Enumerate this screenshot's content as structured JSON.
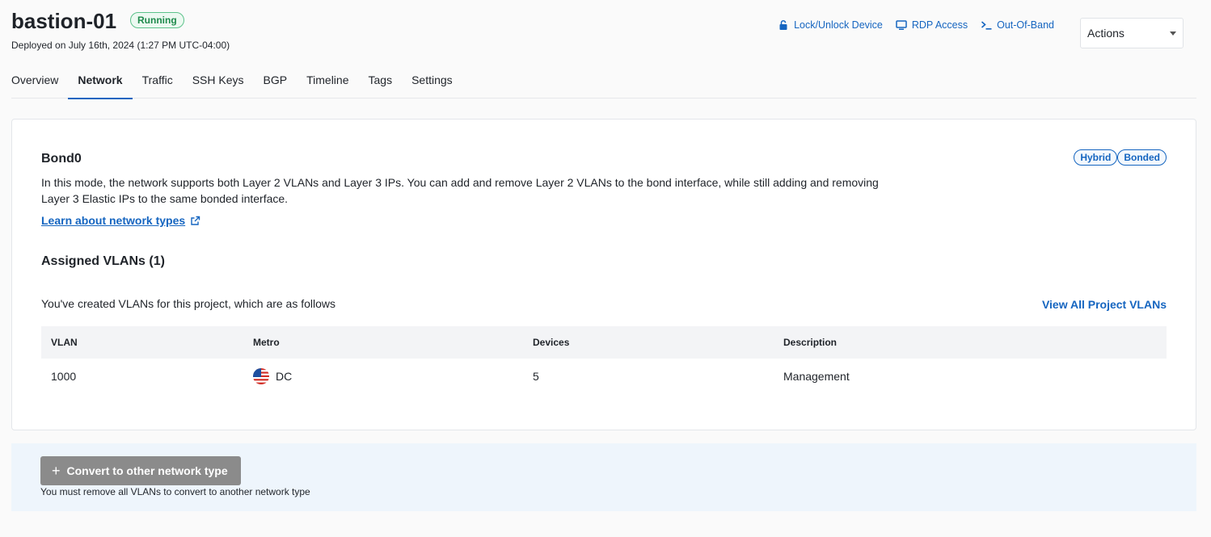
{
  "device": {
    "name": "bastion-01",
    "status": "Running",
    "deployed": "Deployed on July 16th, 2024 (1:27 PM UTC-04:00)"
  },
  "header_links": {
    "lock": "Lock/Unlock Device",
    "rdp": "RDP Access",
    "oob": "Out-Of-Band"
  },
  "actions": {
    "label": "Actions"
  },
  "tabs": [
    "Overview",
    "Network",
    "Traffic",
    "SSH Keys",
    "BGP",
    "Timeline",
    "Tags",
    "Settings"
  ],
  "active_tab": "Network",
  "bond": {
    "title": "Bond0",
    "pills": [
      "Hybrid",
      "Bonded"
    ],
    "description": "In this mode, the network supports both Layer 2 VLANs and Layer 3 IPs. You can add and remove Layer 2 VLANs to the bond interface, while still adding and removing Layer 3 Elastic IPs to the same bonded interface.",
    "learn_link": "Learn about network types"
  },
  "vlans": {
    "heading": "Assigned VLANs (1)",
    "intro": "You've created VLANs for this project, which are as follows",
    "view_all": "View All Project VLANs",
    "columns": [
      "VLAN",
      "Metro",
      "Devices",
      "Description"
    ],
    "rows": [
      {
        "vlan": "1000",
        "metro": "DC",
        "devices": "5",
        "description": "Management"
      }
    ]
  },
  "convert": {
    "button": "Convert to other network type",
    "note": "You must remove all VLANs to convert to another network type"
  },
  "colors": {
    "link": "#1565c0",
    "status_green": "#1f8a4c",
    "disabled_button": "#8b8b8b",
    "panel_bg": "#eef5fc"
  }
}
